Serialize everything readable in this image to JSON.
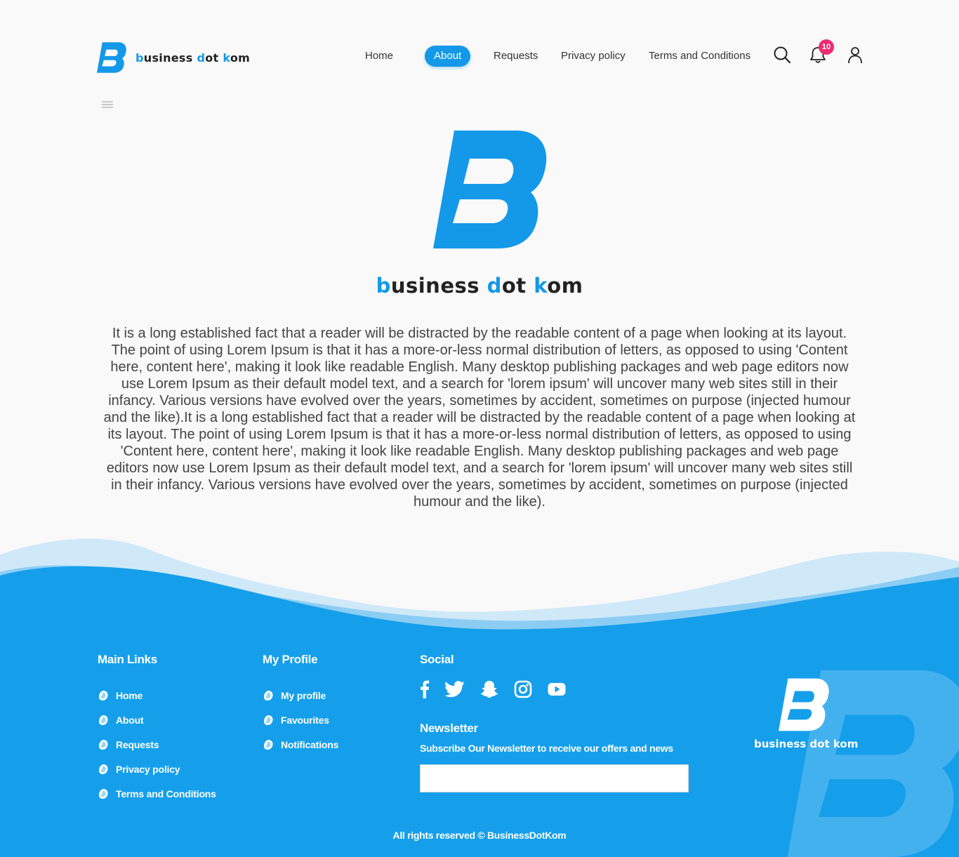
{
  "brand": {
    "parts": [
      {
        "text": "b",
        "accent": true
      },
      {
        "text": "usiness ",
        "accent": false
      },
      {
        "text": "d",
        "accent": true
      },
      {
        "text": "ot ",
        "accent": false
      },
      {
        "text": "k",
        "accent": true
      },
      {
        "text": "om",
        "accent": false
      }
    ],
    "footer_name": "business dot kom",
    "accent_color": "#1399e8",
    "footer_color": "#159fea"
  },
  "nav": {
    "items": [
      {
        "label": "Home",
        "active": false
      },
      {
        "label": "About",
        "active": true
      },
      {
        "label": "Requests",
        "active": false
      },
      {
        "label": "Privacy policy",
        "active": false
      },
      {
        "label": "Terms and Conditions",
        "active": false
      }
    ]
  },
  "header_icons": {
    "search": "search-icon",
    "notifications": "bell-icon",
    "notification_count": "10",
    "profile": "user-icon",
    "menu": "hamburger-icon"
  },
  "about": {
    "text": "It is a long established fact that a reader will be distracted by the readable content of a page when looking at its layout. The point of using Lorem Ipsum is that it has a more-or-less normal distribution of letters, as opposed to using 'Content here, content here', making it look like readable English. Many desktop publishing packages and web page editors now use Lorem Ipsum as their default model text, and a search for 'lorem ipsum' will uncover many web sites still in their infancy. Various versions have evolved over the years, sometimes by accident, sometimes on purpose (injected humour and the like).It is a long established fact that a reader will be distracted by the readable content of a page when looking at its layout. The point of using Lorem Ipsum is that it has a more-or-less normal distribution of letters, as opposed to using 'Content here, content here', making it look like readable English. Many desktop publishing packages and web page editors now use Lorem Ipsum as their default model text, and a search for 'lorem ipsum' will uncover many web sites still in their infancy. Various versions have evolved over the years, sometimes by accident, sometimes on purpose (injected humour and the like)."
  },
  "footer": {
    "main_links": {
      "title": "Main Links",
      "items": [
        "Home",
        "About",
        "Requests",
        "Privacy policy",
        "Terms and Conditions"
      ]
    },
    "profile": {
      "title": "My Profile",
      "items": [
        "My profile",
        "Favourites",
        "Notifications"
      ]
    },
    "social": {
      "title": "Social",
      "icons": [
        "facebook-icon",
        "twitter-icon",
        "snapchat-icon",
        "instagram-icon",
        "youtube-icon"
      ]
    },
    "newsletter": {
      "title": "Newsletter",
      "subtitle": "Subscribe Our Newsletter to receive our offers and news",
      "value": ""
    },
    "copyright": "All rights reserved © BusinessDotKom"
  }
}
